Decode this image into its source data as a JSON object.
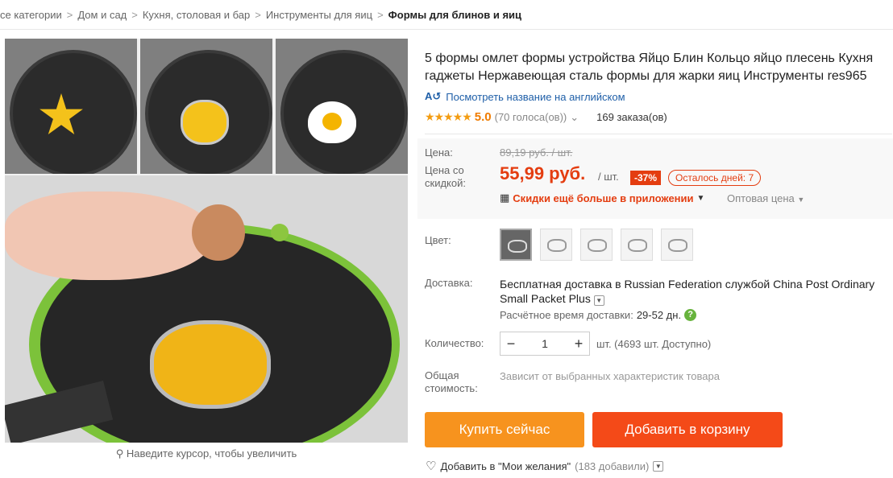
{
  "breadcrumb": [
    "се категории",
    "Дом и сад",
    "Кухня, столовая и бар",
    "Инструменты для яиц",
    "Формы для блинов и яиц"
  ],
  "gallery": {
    "zoom_hint": "Наведите курсор, чтобы увеличить"
  },
  "product": {
    "title": "5 формы омлет формы устройства Яйцо Блин Кольцо яйцо плесень Кухня гаджеты Нержавеющая сталь формы для жарки яиц Инструменты res965",
    "translate_link": "Посмотреть название на английском",
    "rating": {
      "stars": "★★★★★",
      "score": "5.0",
      "votes": "(70 голоса(ов))",
      "orders": "169 заказа(ов)"
    }
  },
  "price": {
    "label": "Цена:",
    "old": "89,19 руб. / шт.",
    "discount_label": "Цена со скидкой:",
    "current": "55,99 руб.",
    "unit": "/ шт.",
    "discount": "-37%",
    "days_left": "Осталось дней: 7",
    "app_deal": "Скидки ещё больше в приложении",
    "wholesale": "Оптовая цена"
  },
  "options": {
    "color_label": "Цвет:",
    "shipping_label": "Доставка:",
    "shipping": "Бесплатная доставка в Russian Federation службой China Post Ordinary Small Packet Plus",
    "delivery_time_label": "Расчётное время доставки:",
    "delivery_time": "29-52 дн.",
    "qty_label": "Количество:",
    "qty": "1",
    "qty_unit": "шт. (4693 шт. Доступно)",
    "total_label": "Общая стоимость:",
    "total": "Зависит от выбранных характеристик товара"
  },
  "actions": {
    "buy": "Купить сейчас",
    "cart": "Добавить в корзину",
    "wishlist": "Добавить в \"Мои желания\"",
    "wishlist_count": "(183 добавили)"
  },
  "colors": {
    "accent": "#e43d10",
    "buy": "#f7931e",
    "cart": "#f44a18",
    "star": "#f39c12",
    "link": "#1f5fa8"
  }
}
